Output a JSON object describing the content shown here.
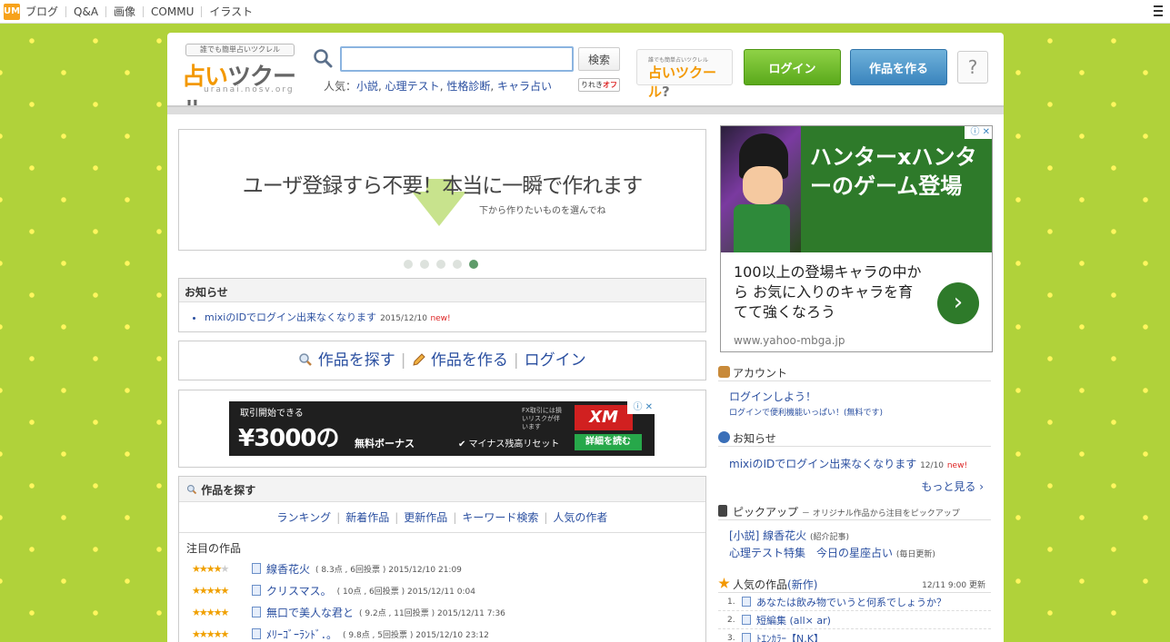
{
  "topbar": {
    "logo": "UM",
    "nav": [
      "ブログ",
      "Q&A",
      "画像",
      "COMMU",
      "イラスト"
    ]
  },
  "header": {
    "logo_tagline": "誰でも簡単占いツクレル",
    "logo_name_a": "占い",
    "logo_name_b": "ツクール",
    "logo_url": "uranai.nosv.org",
    "search_placeholder": "",
    "search_button": "検索",
    "popular_label": "人気：",
    "popular_links": [
      "小説",
      "心理テスト",
      "性格診断",
      "キャラ占い"
    ],
    "rewrite_a": "りれき",
    "rewrite_b": "オフ",
    "logo2_tag": "誰でも簡単占いツクレル",
    "logo2_name_a": "占いツクール",
    "logo2_name_b": "?",
    "login_button": "ログイン",
    "create_button": "作品を作る",
    "help_button": "?"
  },
  "hero": {
    "headline": "ユーザ登録すら不要！本当に一瞬で作れます",
    "subtext": "下から作りたいものを選んでね",
    "slides": 5,
    "active_slide": 5
  },
  "notice": {
    "title": "お知らせ",
    "item": "mixiのIDでログイン出来なくなります",
    "date": "2015/12/10",
    "badge": "new!"
  },
  "navline": {
    "find": "作品を探す",
    "create": "作品を作る",
    "login": "ログイン",
    "sep": "|"
  },
  "ad_banner": {
    "line1": "取引開始できる",
    "amount": "¥3000の",
    "bonus": "無料ボーナス",
    "risk": "FX取引には損いリスクが伴います",
    "brand": "XM",
    "reset": "✔ マイナス残高リセット",
    "cta": "詳細を読む",
    "adchoice": "ⓘ ✕"
  },
  "find": {
    "title": "作品を探す",
    "links": [
      "ランキング",
      "新着作品",
      "更新作品",
      "キーワード検索",
      "人気の作者"
    ],
    "featured_label": "注目の作品",
    "works": [
      {
        "stars": 4,
        "title": "線香花火",
        "meta": "( 8.3点 , 6回投票 ) 2015/12/10 21:09"
      },
      {
        "stars": 5,
        "title": "クリスマス。",
        "meta": "( 10点 , 6回投票 ) 2015/12/11 0:04"
      },
      {
        "stars": 5,
        "title": "無口で美人な君と",
        "meta": "( 9.2点 , 11回投票 ) 2015/12/11 7:36"
      },
      {
        "stars": 5,
        "title": "ﾒﾘｰｺﾞｰﾗﾝﾄﾞ．。",
        "meta": "( 9.8点 , 5回投票 ) 2015/12/10 23:12"
      }
    ]
  },
  "ad_right": {
    "headline": "ハンターxハンターのゲーム登場",
    "body": "100以上の登場キャラの中から お気に入りのキャラを育てて強くなろう",
    "url": "www.yahoo-mbga.jp",
    "arrow": "›",
    "adchoice": "ⓘ ✕"
  },
  "account": {
    "title": "アカウント",
    "link": "ログインしよう！",
    "sub": "ログインで便利機能いっぱい！(無料です)"
  },
  "info": {
    "title": "お知らせ",
    "item": "mixiのIDでログイン出来なくなります",
    "date": "12/10",
    "badge": "new!",
    "more": "もっと見る ›"
  },
  "pickup": {
    "title": "ピックアップ",
    "subtitle": "－ オリジナル作品から注目をピックアップ",
    "item1": "[小説] 線香花火",
    "item1_note": "(紹介記事)",
    "item2a": "心理テスト特集",
    "item2b": "今日の星座占い",
    "item2_note": "(毎日更新)"
  },
  "popular": {
    "title": "人気の作品",
    "title_tag": "(新作)",
    "updated": "12/11 9:00 更新",
    "items": [
      {
        "n": "1.",
        "title": "あなたは飲み物でいうと何系でしょうか？"
      },
      {
        "n": "2.",
        "title": "短編集 (all× ar)"
      },
      {
        "n": "3.",
        "title": "ﾄｴﾝｶﾗｰ【N.K】"
      }
    ]
  }
}
